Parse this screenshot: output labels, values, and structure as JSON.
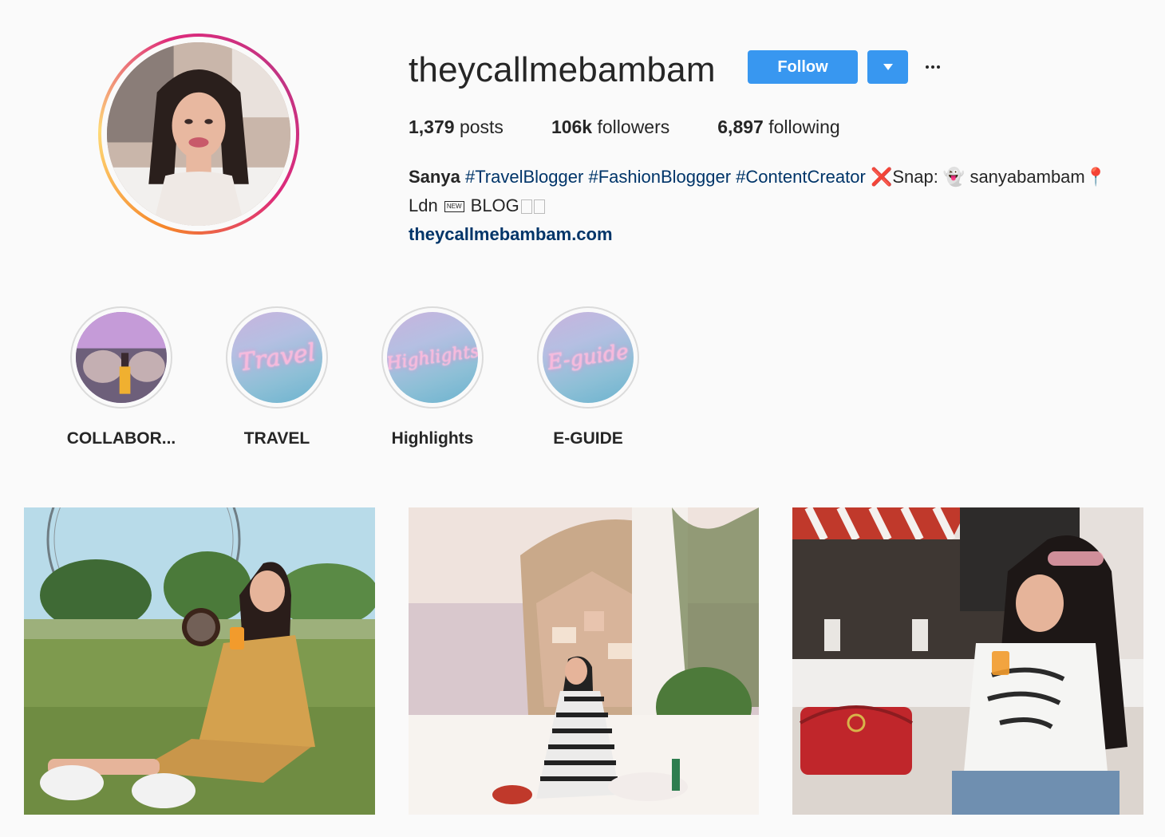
{
  "profile": {
    "username": "theycallmebambam",
    "follow_label": "Follow",
    "stats": {
      "posts_count": "1,379",
      "posts_label": "posts",
      "followers_count": "106k",
      "followers_label": "followers",
      "following_count": "6,897",
      "following_label": "following"
    },
    "bio": {
      "name": "Sanya",
      "hashtags": [
        "#TravelBlogger",
        "#FashionBloggger",
        "#ContentCreator"
      ],
      "snap_text": "❌Snap: 👻 sanyabambam📍",
      "line2_prefix": "Ldn",
      "line2_new": "NEW",
      "line2_blog": "BLOG",
      "website": "theycallmebambam.com"
    }
  },
  "highlights": [
    {
      "label": "COLLABOR...",
      "cover": "photo"
    },
    {
      "label": "TRAVEL",
      "cover_text": "Travel"
    },
    {
      "label": "Highlights",
      "cover_text": "Highlights"
    },
    {
      "label": "E-GUIDE",
      "cover_text": "E-guide"
    }
  ],
  "posts": [
    {
      "subject": "london-eye-park"
    },
    {
      "subject": "positano-terrace"
    },
    {
      "subject": "cafe-gucci-bag"
    }
  ],
  "colors": {
    "accent": "#3897f0",
    "link": "#003569",
    "text": "#262626",
    "background": "#fafafa"
  }
}
